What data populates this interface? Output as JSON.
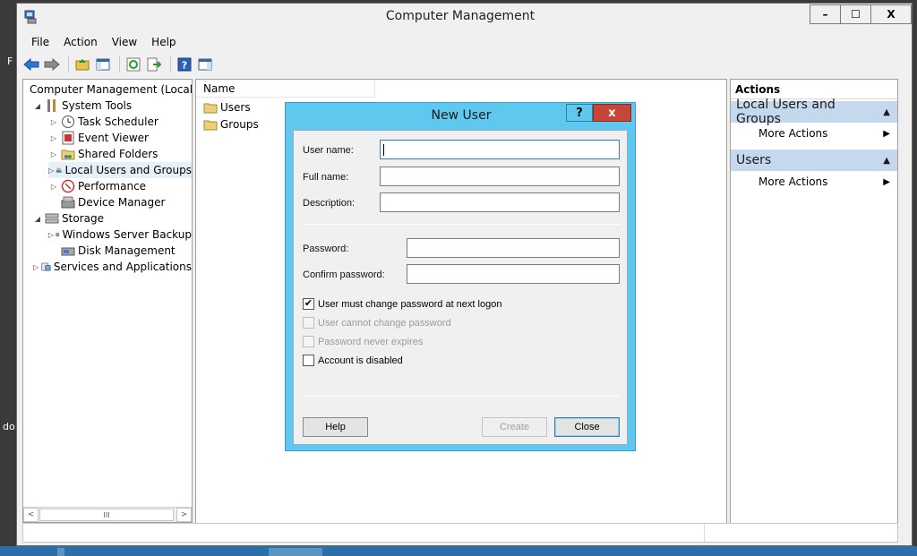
{
  "desktop": {
    "left_glyph_1": "F",
    "left_glyph_2": "do"
  },
  "window": {
    "title": "Computer Management",
    "controls": {
      "minimize": "–",
      "maximize": "☐",
      "close": "X"
    }
  },
  "menu": [
    "File",
    "Action",
    "View",
    "Help"
  ],
  "tree": [
    {
      "label": "Computer Management (Local",
      "icon": "computer-management-icon",
      "expander": ""
    },
    {
      "label": "System Tools",
      "icon": "tools-icon",
      "expander": "◢"
    },
    {
      "label": "Task Scheduler",
      "icon": "clock-icon",
      "expander": "▷"
    },
    {
      "label": "Event Viewer",
      "icon": "event-viewer-icon",
      "expander": "▷"
    },
    {
      "label": "Shared Folders",
      "icon": "shared-folder-icon",
      "expander": "▷"
    },
    {
      "label": "Local Users and Groups",
      "icon": "users-icon",
      "expander": "▷"
    },
    {
      "label": "Performance",
      "icon": "performance-icon",
      "expander": "▷"
    },
    {
      "label": "Device Manager",
      "icon": "device-manager-icon",
      "expander": ""
    },
    {
      "label": "Storage",
      "icon": "storage-icon",
      "expander": "◢"
    },
    {
      "label": "Windows Server Backup",
      "icon": "backup-icon",
      "expander": "▷"
    },
    {
      "label": "Disk Management",
      "icon": "disk-icon",
      "expander": ""
    },
    {
      "label": "Services and Applications",
      "icon": "services-icon",
      "expander": "▷"
    }
  ],
  "tree_scroll": {
    "left": "<",
    "right": ">",
    "thumb": "III"
  },
  "list": {
    "column": "Name",
    "items": [
      {
        "label": "Users",
        "icon": "folder-icon"
      },
      {
        "label": "Groups",
        "icon": "folder-icon"
      }
    ]
  },
  "actions": {
    "header": "Actions",
    "sections": [
      {
        "title": "Local Users and Groups",
        "item": "More Actions"
      },
      {
        "title": "Users",
        "item": "More Actions"
      }
    ],
    "collapse_glyph": "▲",
    "submenu_glyph": "▶"
  },
  "dialog": {
    "title": "New User",
    "help_glyph": "?",
    "close_glyph": "x",
    "fields": {
      "username": {
        "label": "User name:",
        "value": ""
      },
      "fullname": {
        "label": "Full name:",
        "value": ""
      },
      "description": {
        "label": "Description:",
        "value": ""
      },
      "password": {
        "label": "Password:",
        "value": ""
      },
      "confirm": {
        "label": "Confirm password:",
        "value": ""
      }
    },
    "checkboxes": [
      {
        "label": "User must change password at next logon",
        "checked": true,
        "enabled": true
      },
      {
        "label": "User cannot change password",
        "checked": false,
        "enabled": false
      },
      {
        "label": "Password never expires",
        "checked": false,
        "enabled": false
      },
      {
        "label": "Account is disabled",
        "checked": false,
        "enabled": true
      }
    ],
    "check_glyph": "✔",
    "buttons": {
      "help": "Help",
      "create": "Create",
      "close": "Close"
    }
  },
  "colors": {
    "dialog_frame": "#5ec8ee",
    "close_red": "#c7463a",
    "actions_section": "#c5d9ee"
  }
}
